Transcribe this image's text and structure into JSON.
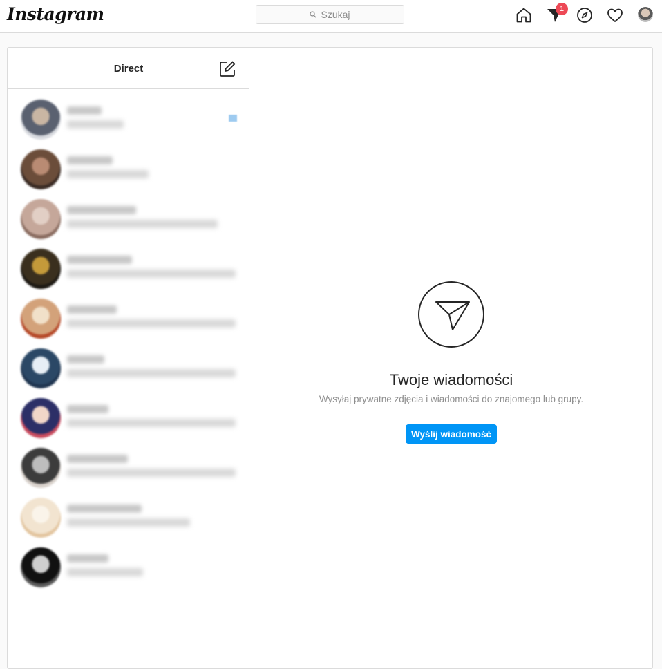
{
  "header": {
    "logo": "Instagram",
    "search_placeholder": "Szukaj",
    "notifications_count": "1"
  },
  "sidebar": {
    "title": "Direct",
    "threads": [
      {
        "avatar_colors": [
          "#5a6170",
          "#c9b6a3",
          "#d9dbe0"
        ],
        "unread": true
      },
      {
        "avatar_colors": [
          "#6b4d3a",
          "#b98b73",
          "#3a2b24"
        ],
        "unread": false
      },
      {
        "avatar_colors": [
          "#c5a79a",
          "#e2cfc5",
          "#8b6d61"
        ],
        "unread": false
      },
      {
        "avatar_colors": [
          "#3a2f1e",
          "#c49a3a",
          "#1e1a14"
        ],
        "unread": false
      },
      {
        "avatar_colors": [
          "#d3a27a",
          "#f1e0c9",
          "#b64a2a"
        ],
        "unread": false
      },
      {
        "avatar_colors": [
          "#2b4866",
          "#e7eef5",
          "#1f3550"
        ],
        "unread": false
      },
      {
        "avatar_colors": [
          "#2c2f67",
          "#f1d6c8",
          "#c94c5f"
        ],
        "unread": false
      },
      {
        "avatar_colors": [
          "#3c3c3c",
          "#bdbdbd",
          "#d9d2cc"
        ],
        "unread": false
      },
      {
        "avatar_colors": [
          "#f2e4d0",
          "#faf4ea",
          "#e3c6a1"
        ],
        "unread": false
      },
      {
        "avatar_colors": [
          "#111111",
          "#cfcfcf",
          "#5b5b5b"
        ],
        "unread": false
      }
    ]
  },
  "main": {
    "heading": "Twoje wiadomości",
    "subtext": "Wysyłaj prywatne zdjęcia i wiadomości do znajomego lub grupy.",
    "button_label": "Wyślij wiadomość"
  },
  "colors": {
    "accent": "#0095f6",
    "badge": "#ed4956",
    "border": "#dbdbdb"
  }
}
